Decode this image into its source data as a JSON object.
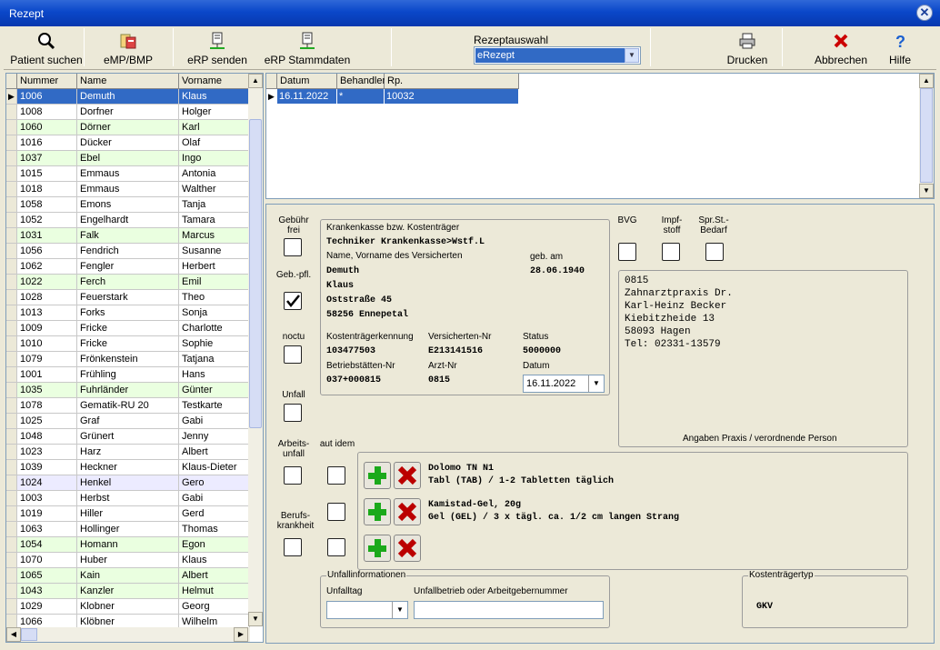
{
  "title": "Rezept",
  "toolbar": {
    "patient": "Patient suchen",
    "emp": "eMP/BMP",
    "erp_send": "eRP senden",
    "erp_stamm": "eRP Stammdaten",
    "rezeptauswahl_label": "Rezeptauswahl",
    "rezeptauswahl_value": "eRezept",
    "print": "Drucken",
    "cancel": "Abbrechen",
    "help": "Hilfe"
  },
  "patients": {
    "headers": [
      "Nummer",
      "Name",
      "Vorname"
    ],
    "rows": [
      [
        "1006",
        "Demuth",
        "Klaus"
      ],
      [
        "1008",
        "Dorfner",
        "Holger"
      ],
      [
        "1060",
        "Dörner",
        "Karl"
      ],
      [
        "1016",
        "Dücker",
        "Olaf"
      ],
      [
        "1037",
        "Ebel",
        "Ingo"
      ],
      [
        "1015",
        "Emmaus",
        "Antonia"
      ],
      [
        "1018",
        "Emmaus",
        "Walther"
      ],
      [
        "1058",
        "Emons",
        "Tanja"
      ],
      [
        "1052",
        "Engelhardt",
        "Tamara"
      ],
      [
        "1031",
        "Falk",
        "Marcus"
      ],
      [
        "1056",
        "Fendrich",
        "Susanne"
      ],
      [
        "1062",
        "Fengler",
        "Herbert"
      ],
      [
        "1022",
        "Ferch",
        "Emil"
      ],
      [
        "1028",
        "Feuerstark",
        "Theo"
      ],
      [
        "1013",
        "Forks",
        "Sonja"
      ],
      [
        "1009",
        "Fricke",
        "Charlotte"
      ],
      [
        "1010",
        "Fricke",
        "Sophie"
      ],
      [
        "1079",
        "Frönkenstein",
        "Tatjana"
      ],
      [
        "1001",
        "Frühling",
        "Hans"
      ],
      [
        "1035",
        "Fuhrländer",
        "Günter"
      ],
      [
        "1078",
        "Gematik-RU 20",
        "Testkarte"
      ],
      [
        "1025",
        "Graf",
        "Gabi"
      ],
      [
        "1048",
        "Grünert",
        "Jenny"
      ],
      [
        "1023",
        "Harz",
        "Albert"
      ],
      [
        "1039",
        "Heckner",
        "Klaus-Dieter"
      ],
      [
        "1024",
        "Henkel",
        "Gero"
      ],
      [
        "1003",
        "Herbst",
        "Gabi"
      ],
      [
        "1019",
        "Hiller",
        "Gerd"
      ],
      [
        "1063",
        "Hollinger",
        "Thomas"
      ],
      [
        "1054",
        "Homann",
        "Egon"
      ],
      [
        "1070",
        "Huber",
        "Klaus"
      ],
      [
        "1065",
        "Kain",
        "Albert"
      ],
      [
        "1043",
        "Kanzler",
        "Helmut"
      ],
      [
        "1029",
        "Klobner",
        "Georg"
      ],
      [
        "1066",
        "Klöbner",
        "Wilhelm"
      ]
    ],
    "row_colors": [
      "sel",
      "w",
      "g",
      "w",
      "g",
      "w",
      "w",
      "w",
      "w",
      "g",
      "w",
      "w",
      "g",
      "w",
      "w",
      "w",
      "w",
      "w",
      "w",
      "g",
      "w",
      "w",
      "w",
      "w",
      "w",
      "l",
      "w",
      "w",
      "w",
      "g",
      "w",
      "g",
      "g",
      "w",
      "w"
    ]
  },
  "prescriptions": {
    "headers": [
      "Datum",
      "Behandler",
      "Rp."
    ],
    "row": [
      "16.11.2022",
      "*",
      "10032"
    ]
  },
  "form": {
    "gebuehr_frei": "Gebühr frei",
    "geb_pfl": "Geb.-pfl.",
    "noctu": "noctu",
    "unfall": "Unfall",
    "arbeitsunfall": "Arbeits-unfall",
    "aut_idem": "aut idem",
    "berufskrankheit": "Berufs-krankheit",
    "bvg": "BVG",
    "impfstoff": "Impf-stoff",
    "sprst": "Spr.St.-Bedarf",
    "kasse_label": "Krankenkasse bzw. Kostenträger",
    "kasse": "Techniker Krankenkasse>Wstf.L",
    "name_label": "Name, Vorname des Versicherten",
    "geb_label": "geb. am",
    "lastname": "Demuth",
    "birth": "28.06.1940",
    "firstname": "Klaus",
    "street": "Oststraße 45",
    "city": "58256  Ennepetal",
    "kk_label": "Kostenträgerkennung",
    "vnr_label": "Versicherten-Nr",
    "status_label": "Status",
    "kk": "103477503",
    "vnr": "E213141516",
    "status": "5000000",
    "bsnr_label": "Betriebstätten-Nr",
    "arzt_label": "Arzt-Nr",
    "datum_label": "Datum",
    "bsnr": "037+000815",
    "arzt": "0815",
    "datum": "16.11.2022",
    "praxis": [
      "0815",
      "Zahnarztpraxis Dr.",
      "Karl-Heinz  Becker",
      "Kiebitzheide  13",
      "58093 Hagen",
      "Tel: 02331-13579"
    ],
    "praxis_label": "Angaben Praxis / verordnende Person",
    "med1_a": "Dolomo TN N1",
    "med1_b": "Tabl (TAB) / 1-2 Tabletten täglich",
    "med2_a": "Kamistad-Gel, 20g",
    "med2_b": "Gel (GEL) / 3 x tägl. ca. 1/2 cm langen Strang",
    "unfall_info": "Unfallinformationen",
    "unfalltag": "Unfalltag",
    "unfallbetrieb": "Unfallbetrieb oder Arbeitgebernummer",
    "kostentraegertyp": "Kostenträgertyp",
    "kt_value": "GKV"
  },
  "colors": {
    "selection": "#316ac5",
    "green_row": "#eaffe0",
    "lilac_row": "#ecebff"
  }
}
